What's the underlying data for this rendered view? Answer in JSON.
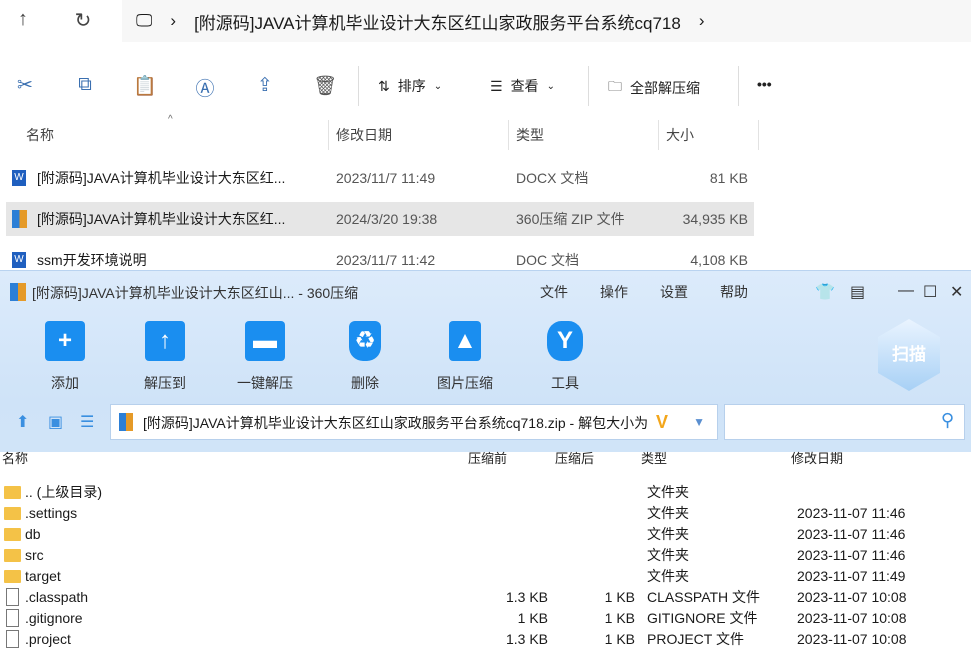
{
  "explorer": {
    "breadcrumb": "[附源码]JAVA计算机毕业设计大东区红山家政服务平台系统cq718",
    "toolbar": {
      "sort": "排序",
      "view": "查看",
      "extract_all": "全部解压缩",
      "more": "•••"
    },
    "columns": [
      "名称",
      "修改日期",
      "类型",
      "大小"
    ],
    "files": [
      {
        "name": "[附源码]JAVA计算机毕业设计大东区红...",
        "date": "2023/11/7 11:49",
        "type": "DOCX 文档",
        "size": "81 KB",
        "icon": "word-icon"
      },
      {
        "name": "[附源码]JAVA计算机毕业设计大东区红...",
        "date": "2024/3/20 19:38",
        "type": "360压缩 ZIP 文件",
        "size": "34,935 KB",
        "icon": "zip-icon",
        "selected": true
      },
      {
        "name": "ssm开发环境说明",
        "date": "2023/11/7 11:42",
        "type": "DOC 文档",
        "size": "4,108 KB",
        "icon": "word-icon"
      }
    ]
  },
  "zip": {
    "title": "[附源码]JAVA计算机毕业设计大东区红山... - 360压缩",
    "menu": [
      "文件",
      "操作",
      "设置",
      "帮助"
    ],
    "tools": [
      "添加",
      "解压到",
      "一键解压",
      "删除",
      "图片压缩",
      "工具"
    ],
    "scan": "扫描",
    "path": "[附源码]JAVA计算机毕业设计大东区红山家政服务平台系统cq718.zip - 解包大小为",
    "columns": [
      "名称",
      "压缩前",
      "压缩后",
      "类型",
      "修改日期"
    ],
    "rows": [
      {
        "name": ".. (上级目录)",
        "before": "",
        "after": "",
        "type": "文件夹",
        "date": "",
        "folder": true
      },
      {
        "name": ".settings",
        "before": "",
        "after": "",
        "type": "文件夹",
        "date": "2023-11-07 11:46",
        "folder": true
      },
      {
        "name": "db",
        "before": "",
        "after": "",
        "type": "文件夹",
        "date": "2023-11-07 11:46",
        "folder": true
      },
      {
        "name": "src",
        "before": "",
        "after": "",
        "type": "文件夹",
        "date": "2023-11-07 11:46",
        "folder": true
      },
      {
        "name": "target",
        "before": "",
        "after": "",
        "type": "文件夹",
        "date": "2023-11-07 11:49",
        "folder": true
      },
      {
        "name": ".classpath",
        "before": "1.3 KB",
        "after": "1 KB",
        "type": "CLASSPATH 文件",
        "date": "2023-11-07 10:08",
        "folder": false
      },
      {
        "name": ".gitignore",
        "before": "1 KB",
        "after": "1 KB",
        "type": "GITIGNORE 文件",
        "date": "2023-11-07 10:08",
        "folder": false
      },
      {
        "name": ".project",
        "before": "1.3 KB",
        "after": "1 KB",
        "type": "PROJECT 文件",
        "date": "2023-11-07 10:08",
        "folder": false
      }
    ]
  }
}
